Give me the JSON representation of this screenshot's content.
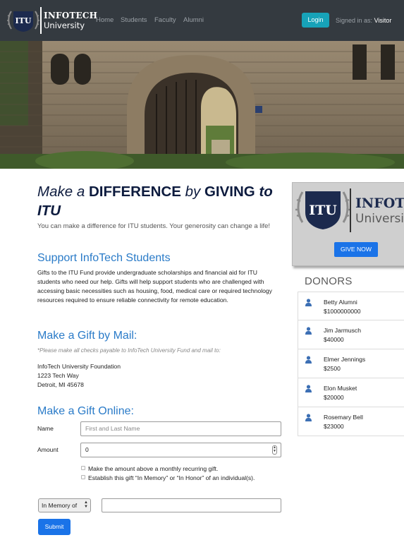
{
  "navbar": {
    "logo_seal_text": "ITU",
    "brand_line1": "INFOTECH",
    "brand_line2": "University",
    "links": [
      "Home",
      "Students",
      "Faculty",
      "Alumni"
    ],
    "login_label": "Login",
    "signed_in_prefix": "Signed in as:",
    "signed_in_user": "Visitor",
    "bg_color": "#343a40"
  },
  "hero": {
    "image": "stone-archway-campus-photo"
  },
  "main": {
    "headline": {
      "w1": "Make a",
      "w2": "DIFFERENCE",
      "w3": "by",
      "w4": "GIVING",
      "w5": "to ITU"
    },
    "lead": "You can make a difference for ITU students. Your generosity can change a life!",
    "support_title": "Support InfoTech Students",
    "support_text": "Gifts to the ITU Fund provide undergraduate scholarships and financial aid for ITU students who need our help. Gifts will help support students who are challenged with accessing basic necessities such as housing, food, medical care or required technology resources required to ensure reliable connectivity for remote education.",
    "mail_title": "Make a Gift by Mail:",
    "mail_note": "*Please make all checks payable to InfoTech University Fund and mail to:",
    "address": {
      "line1": "InfoTech University Foundation",
      "line2": "1223 Tech Way",
      "line3": "Detroit, MI 45678"
    },
    "online_title": "Make a Gift Online:",
    "form": {
      "name_label": "Name",
      "name_placeholder": "First and Last Name",
      "amount_label": "Amount",
      "amount_value": "0",
      "recurring_label": "Make the amount above a monthly recurring gift.",
      "memory_label": "Establish this gift “In Memory” or “In Honor” of an individual(s).",
      "memory_select_value": "In Memory of",
      "honoree_value": "",
      "submit_label": "Submit"
    }
  },
  "sidebar": {
    "promo_seal_text": "ITU",
    "promo_brand_line1": "INFOTECH",
    "promo_brand_line2": "University",
    "give_label": "GIVE NOW",
    "donors_title": "DONORS",
    "donors": [
      {
        "name": "Betty Alumni",
        "amount": "$1000000000"
      },
      {
        "name": "Jim Jarmusch",
        "amount": "$40000"
      },
      {
        "name": "Elmer Jennings",
        "amount": "$2500"
      },
      {
        "name": "Elon Musket",
        "amount": "$20000"
      },
      {
        "name": "Rosemary Bell",
        "amount": "$23000"
      }
    ]
  },
  "colors": {
    "accent_blue": "#1a73e8",
    "heading_blue": "#2a7bc8",
    "login_teal": "#17a2b8",
    "seal_navy": "#1c2a4e"
  }
}
